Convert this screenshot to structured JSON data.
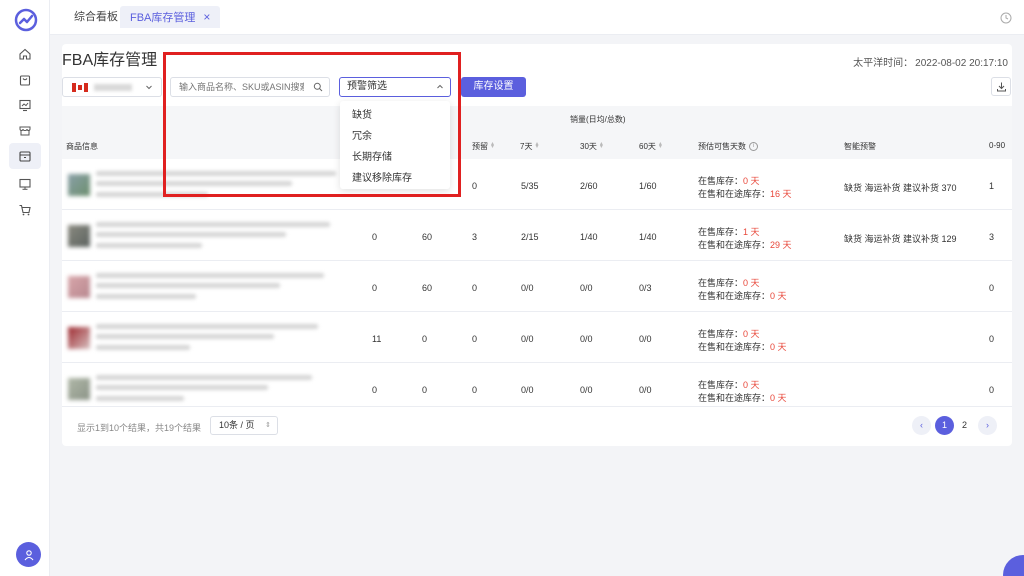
{
  "tabs": [
    {
      "label": "综合看板"
    },
    {
      "label": "FBA库存管理",
      "close": "×"
    }
  ],
  "page": {
    "title": "FBA库存管理",
    "pacific_time_label": "太平洋时间：",
    "pacific_time_value": "2022-08-02 20:17:10"
  },
  "filters": {
    "search_placeholder": "输入商品名称、SKU或ASIN搜索",
    "alert_select_label": "预警筛选",
    "dropdown_options": [
      "缺货",
      "冗余",
      "长期存储",
      "建议移除库存"
    ],
    "settings_button": "库存设置"
  },
  "table": {
    "group_header": "销量(日均/总数)",
    "headers": {
      "product": "商品信息",
      "reserved": "预留",
      "d7": "7天",
      "d30": "30天",
      "d60": "60天",
      "days_sellable": "预估可售天数",
      "smart_alert": "智能预警",
      "age_0_90": "0-90"
    },
    "rows": [
      {
        "c1": "",
        "c2": "",
        "reserved": "0",
        "d7": "5/35",
        "d30": "2/60",
        "d60": "1/60",
        "line1_label": "在售库存：",
        "line1_val": "0 天",
        "line2_label": "在售和在途库存：",
        "line2_val": "16 天",
        "alert": "缺货 海运补货 建议补货 370",
        "age": "1"
      },
      {
        "c1": "0",
        "c2": "60",
        "reserved": "3",
        "d7": "2/15",
        "d30": "1/40",
        "d60": "1/40",
        "line1_label": "在售库存：",
        "line1_val": "1 天",
        "line2_label": "在售和在途库存：",
        "line2_val": "29 天",
        "alert": "缺货 海运补货 建议补货 129",
        "age": "3"
      },
      {
        "c1": "0",
        "c2": "60",
        "reserved": "0",
        "d7": "0/0",
        "d30": "0/0",
        "d60": "0/3",
        "line1_label": "在售库存：",
        "line1_val": "0 天",
        "line2_label": "在售和在途库存：",
        "line2_val": "0 天",
        "alert": "",
        "age": "0"
      },
      {
        "c1": "11",
        "c2": "0",
        "reserved": "0",
        "d7": "0/0",
        "d30": "0/0",
        "d60": "0/0",
        "line1_label": "在售库存：",
        "line1_val": "0 天",
        "line2_label": "在售和在途库存：",
        "line2_val": "0 天",
        "alert": "",
        "age": "0"
      },
      {
        "c1": "0",
        "c2": "0",
        "reserved": "0",
        "d7": "0/0",
        "d30": "0/0",
        "d60": "0/0",
        "line1_label": "在售库存：",
        "line1_val": "0 天",
        "line2_label": "在售和在途库存：",
        "line2_val": "0 天",
        "alert": "",
        "age": "0"
      }
    ]
  },
  "pagination": {
    "summary": "显示1到10个结果，共19个结果",
    "page_size": "10条 / 页",
    "pages": [
      "1",
      "2"
    ],
    "prev": "‹",
    "next": "›"
  },
  "colors": {
    "accent": "#5b5fde",
    "highlight": "#e02020",
    "warning_text": "#e8473a"
  },
  "icons": [
    "logo-icon",
    "home-icon",
    "bag-icon",
    "chart-icon",
    "store-icon",
    "box-icon",
    "monitor-icon",
    "cart-icon",
    "user-icon",
    "clock-icon",
    "search-icon",
    "download-icon"
  ]
}
